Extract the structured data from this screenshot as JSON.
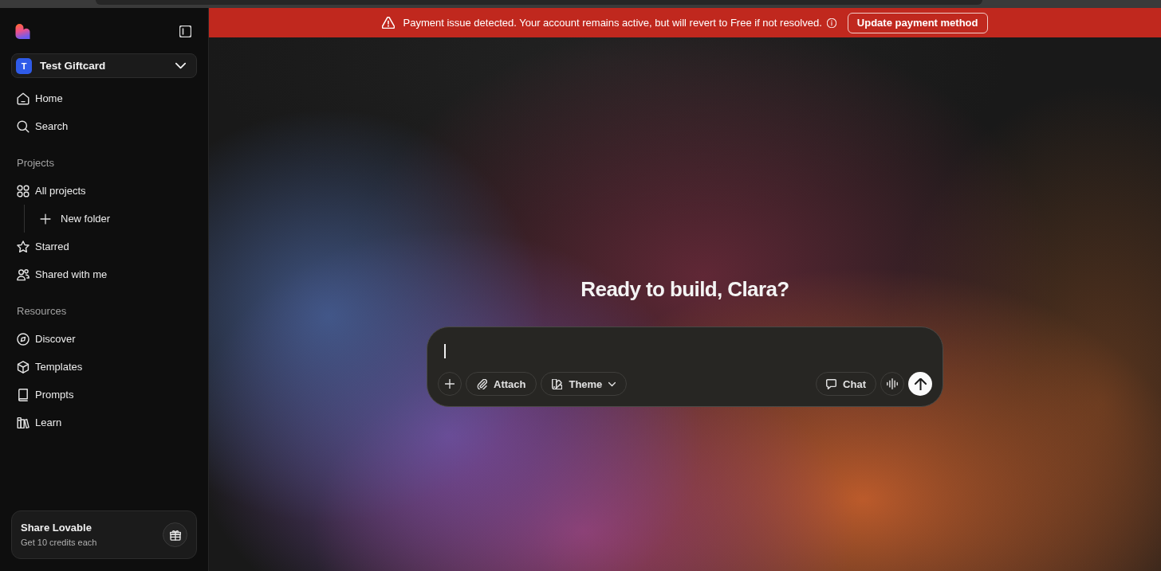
{
  "sidebar": {
    "workspace": {
      "initial": "T",
      "name": "Test Giftcard"
    },
    "nav": [
      {
        "label": "Home"
      },
      {
        "label": "Search"
      }
    ],
    "sections": [
      {
        "title": "Projects",
        "items": [
          {
            "label": "All projects",
            "children": [
              {
                "label": "New folder"
              }
            ]
          },
          {
            "label": "Starred"
          },
          {
            "label": "Shared with me"
          }
        ]
      },
      {
        "title": "Resources",
        "items": [
          {
            "label": "Discover"
          },
          {
            "label": "Templates"
          },
          {
            "label": "Prompts"
          },
          {
            "label": "Learn"
          }
        ]
      }
    ],
    "promo": {
      "title": "Share Lovable",
      "subtitle": "Get 10 credits each"
    }
  },
  "banner": {
    "message": "Payment issue detected. Your account remains active, but will revert to Free if not resolved.",
    "action": "Update payment method"
  },
  "main": {
    "heading": "Ready to build, Clara?",
    "prompt": {
      "focused": true,
      "tools": [
        {
          "label": "Attach",
          "dropdown": false
        },
        {
          "label": "Theme",
          "dropdown": true
        }
      ],
      "mode": {
        "label": "Chat"
      }
    }
  }
}
